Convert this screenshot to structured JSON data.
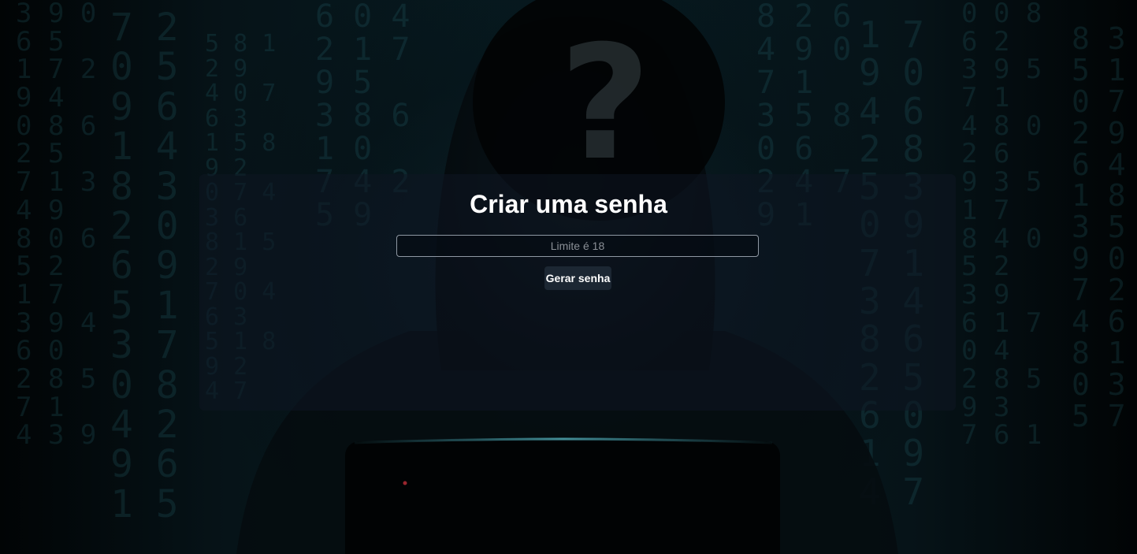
{
  "header": {
    "title": "Criar uma senha"
  },
  "form": {
    "limit_placeholder": "Limite é 18",
    "limit_value": "",
    "generate_label": "Gerar senha"
  },
  "background": {
    "symbol": "?"
  },
  "colors": {
    "panel": "#0e1622",
    "button": "#1c2733",
    "title": "#ffffff",
    "digits": "#286e78"
  }
}
